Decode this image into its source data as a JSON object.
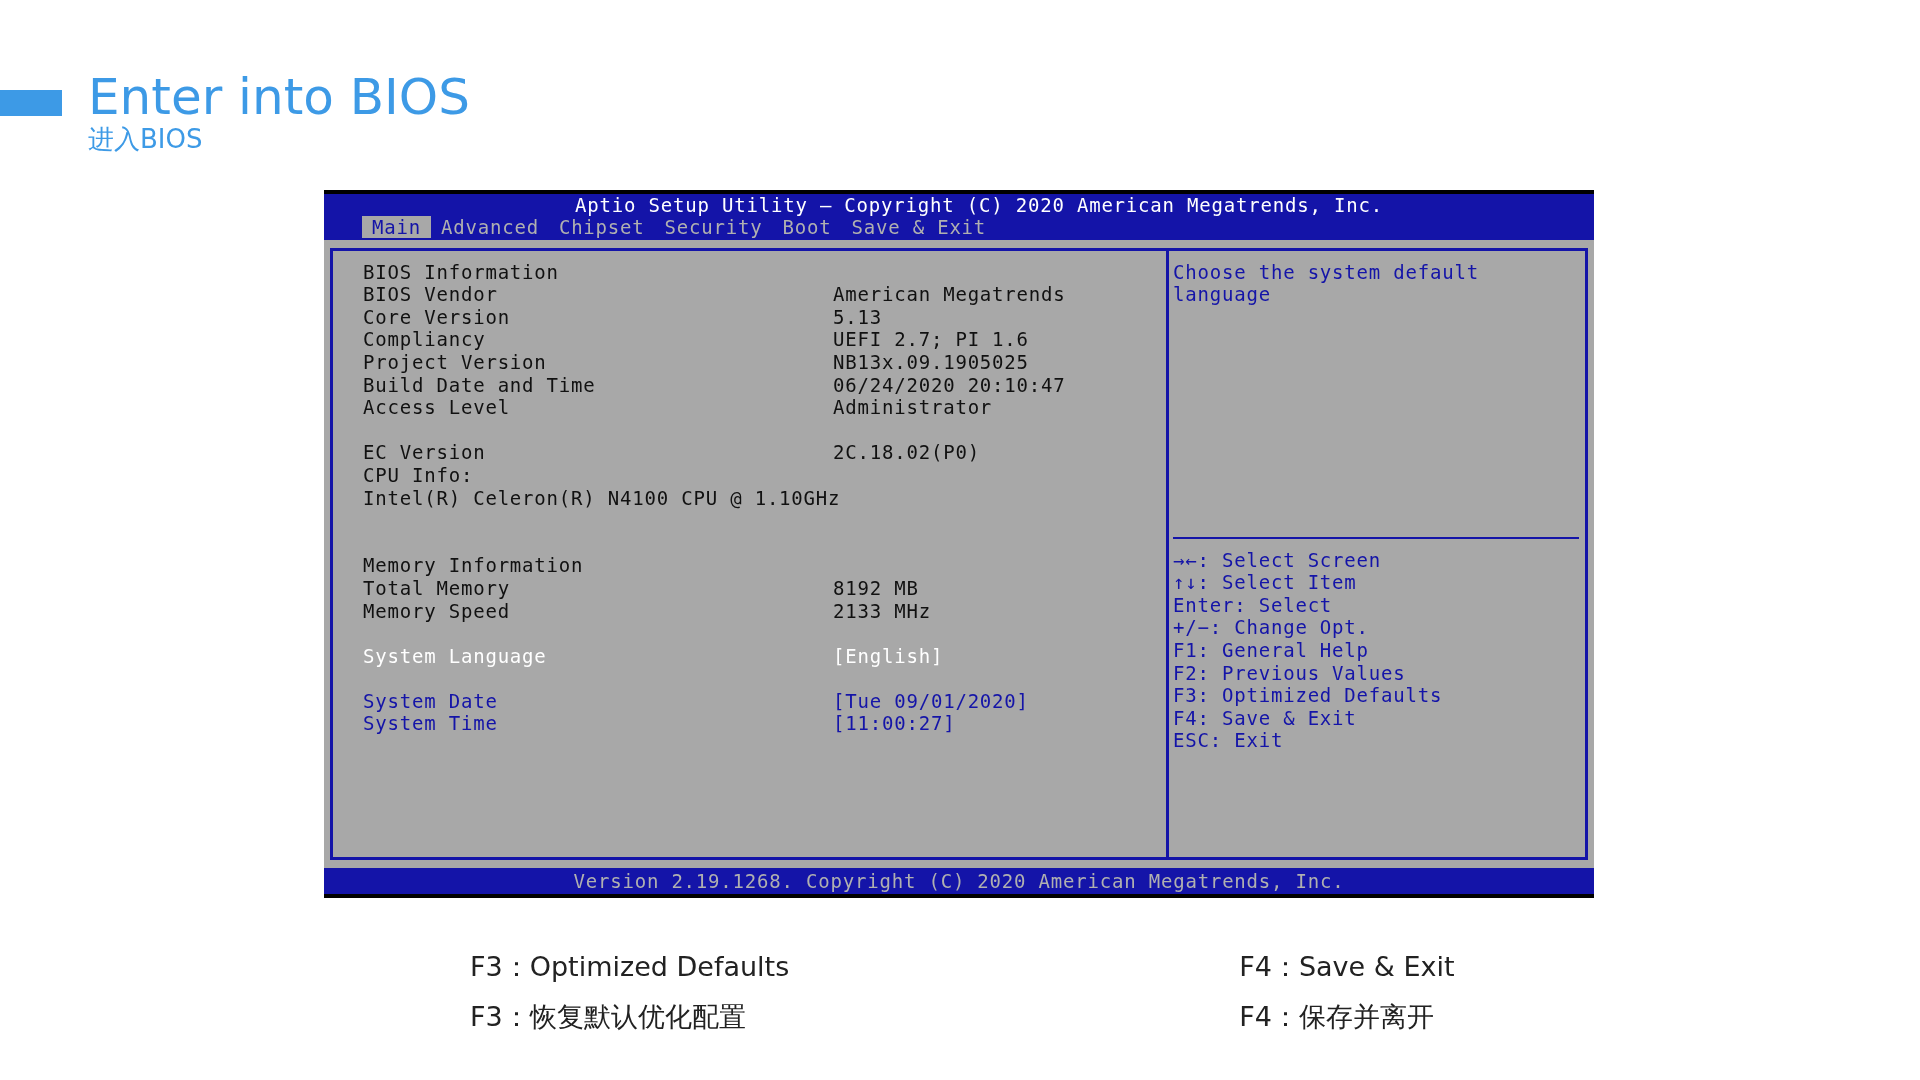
{
  "slide": {
    "title": "Enter into BIOS",
    "subtitle": "进入BIOS"
  },
  "bios": {
    "header": "Aptio Setup Utility – Copyright (C) 2020 American Megatrends, Inc.",
    "tabs": [
      {
        "label": "Main",
        "selected": true
      },
      {
        "label": "Advanced",
        "selected": false
      },
      {
        "label": "Chipset",
        "selected": false
      },
      {
        "label": "Security",
        "selected": false
      },
      {
        "label": "Boot",
        "selected": false
      },
      {
        "label": "Save & Exit",
        "selected": false
      }
    ],
    "groups": [
      [
        {
          "kind": "info",
          "label": "BIOS Information"
        },
        {
          "kind": "info",
          "label": "BIOS Vendor",
          "value": "American Megatrends"
        },
        {
          "kind": "info",
          "label": "Core Version",
          "value": "5.13"
        },
        {
          "kind": "info",
          "label": "Compliancy",
          "value": "UEFI 2.7; PI 1.6"
        },
        {
          "kind": "info",
          "label": "Project Version",
          "value": "NB13x.09.1905025"
        },
        {
          "kind": "info",
          "label": "Build Date and Time",
          "value": "06/24/2020 20:10:47"
        },
        {
          "kind": "info",
          "label": "Access Level",
          "value": "Administrator"
        }
      ],
      [
        {
          "kind": "info",
          "label": "EC Version",
          "value": "2C.18.02(P0)"
        },
        {
          "kind": "info",
          "label": "CPU Info:"
        },
        {
          "kind": "info",
          "label": "Intel(R) Celeron(R) N4100 CPU @ 1.10GHz"
        }
      ],
      [
        {
          "kind": "info",
          "label": "Memory Information"
        },
        {
          "kind": "info",
          "label": "Total Memory",
          "value": "8192 MB"
        },
        {
          "kind": "info",
          "label": "Memory Speed",
          "value": "2133 MHz"
        }
      ],
      [
        {
          "kind": "setting",
          "label": "System Language",
          "value": "[English]",
          "selected": true
        }
      ],
      [
        {
          "kind": "setting",
          "label": "System Date",
          "value": "[Tue 09/01/2020]",
          "selected": false
        },
        {
          "kind": "setting",
          "label": "System Time",
          "value": "[11:00:27]",
          "selected": false
        }
      ]
    ],
    "help": "Choose the system default language",
    "keys": [
      "→←: Select Screen",
      "↑↓: Select Item",
      "Enter: Select",
      "+/−: Change Opt.",
      "F1: General Help",
      "F2: Previous Values",
      "F3: Optimized Defaults",
      "F4: Save & Exit",
      "ESC: Exit"
    ],
    "footer": "Version 2.19.1268. Copyright (C) 2020 American Megatrends, Inc."
  },
  "notes": [
    [
      "F3：Optimized Defaults",
      "F3：恢复默认优化配置"
    ],
    [
      "F4：Save & Exit",
      "F4：保存并离开"
    ]
  ]
}
